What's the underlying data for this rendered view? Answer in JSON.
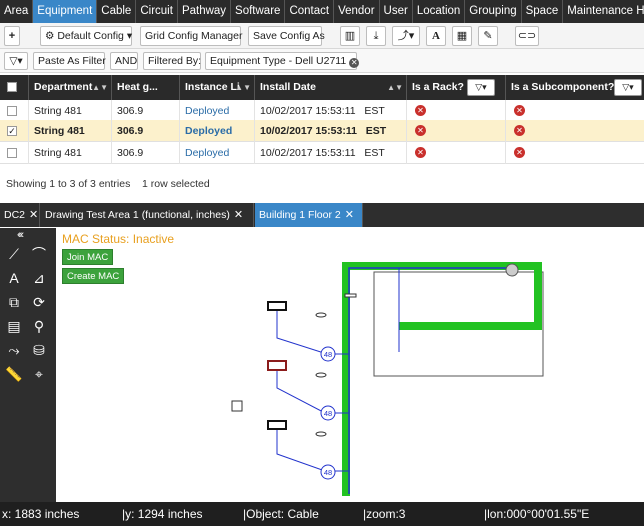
{
  "nav": {
    "items": [
      "Area",
      "Equipment",
      "Cable",
      "Circuit",
      "Pathway",
      "Software",
      "Contact",
      "Vendor",
      "User",
      "Location",
      "Grouping",
      "Space",
      "Maintenance Hole"
    ],
    "active": "Equipment"
  },
  "toolbar": {
    "add": "+",
    "default_config": "Default Config",
    "grid_config_manager": "Grid Config Manager",
    "save_config_as": "Save Config As"
  },
  "filterbar": {
    "filter_btn": "▽▾",
    "paste_as_filter": "Paste As Filter",
    "and": "AND",
    "filtered_by": "Filtered By:",
    "filter_chip": "Equipment Type - Dell U2711"
  },
  "grid": {
    "columns": [
      "Department",
      "Heat g...",
      "Instance Li",
      "Install Date",
      "Is a Rack?",
      "Is a Subcomponent?"
    ],
    "rows": [
      {
        "department": "String 481",
        "heat": "306.9",
        "instance": "Deployed",
        "install_date": "10/02/2017 15:53:11",
        "tz": "EST",
        "checked": ""
      },
      {
        "department": "String 481",
        "heat": "306.9",
        "instance": "Deployed",
        "install_date": "10/02/2017 15:53:11",
        "tz": "EST",
        "checked": "✓"
      },
      {
        "department": "String 481",
        "heat": "306.9",
        "instance": "Deployed",
        "install_date": "10/02/2017 15:53:11",
        "tz": "EST",
        "checked": ""
      }
    ],
    "summary": "Showing 1 to 3 of 3 entries    1 row selected"
  },
  "tabs": [
    {
      "label": "DC2"
    },
    {
      "label": "Drawing Test Area 1 (functional, inches)"
    },
    {
      "label": "Building 1 Floor 2"
    }
  ],
  "canvas": {
    "mac_status": "MAC Status: Inactive",
    "join_mac": "Join MAC",
    "create_mac": "Create MAC",
    "port_label": "48"
  },
  "statusbar": {
    "x": "x: 1883 inches",
    "y": "|y: 1294 inches",
    "object": "|Object: Cable",
    "zoom": "|zoom:3",
    "lon": "|lon:000°00'01.55\"E"
  },
  "colors": {
    "nav_bg": "#2b2b2b",
    "active": "#3a87c8",
    "selected_row": "#fcf1cc",
    "pathway_green": "#22c222",
    "cable_blue": "#2233cc",
    "mac_orange": "#e8a020"
  }
}
